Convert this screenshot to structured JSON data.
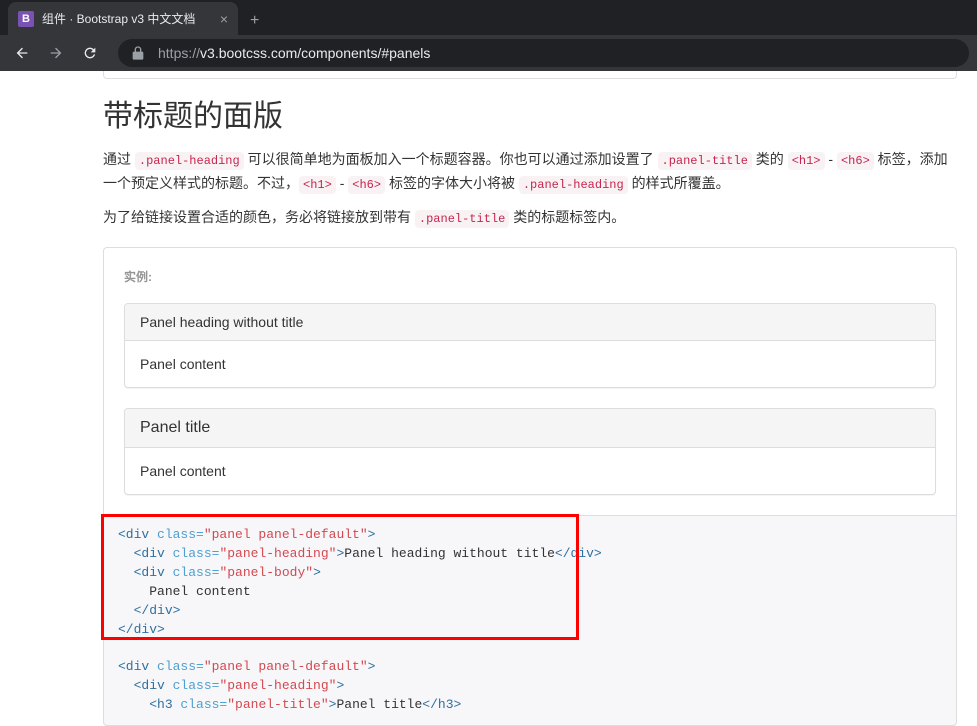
{
  "browser": {
    "tab_title": "组件 · Bootstrap v3 中文文档",
    "tab_favicon_letter": "B",
    "url_protocol": "https://",
    "url_rest": "v3.bootcss.com/components/#panels"
  },
  "page": {
    "heading": "带标题的面版",
    "para1_pre": "通过 ",
    "para1_code1": ".panel-heading",
    "para1_mid1": " 可以很简单地为面板加入一个标题容器。你也可以通过添加设置了 ",
    "para1_code2": ".panel-title",
    "para1_mid2": " 类的 ",
    "para1_code3": "<h1>",
    "para1_dash": " - ",
    "para1_code4": "<h6>",
    "para1_mid3": " 标签，添加一个预定义样式的标题。不过，",
    "para1_code5": "<h1>",
    "para1_code6": "<h6>",
    "para1_mid4": " 标签的字体大小将被 ",
    "para1_code7": ".panel-heading",
    "para1_end": " 的样式所覆盖。",
    "para2_pre": "为了给链接设置合适的颜色，务必将链接放到带有 ",
    "para2_code1": ".panel-title",
    "para2_end": " 类的标题标签内。",
    "example_label": "实例:",
    "panel1_heading": "Panel heading without title",
    "panel1_body": "Panel content",
    "panel2_title": "Panel title",
    "panel2_body": "Panel content",
    "code1_l1_a": "<div",
    "code1_l1_b": " class=",
    "code1_l1_c": "\"panel panel-default\"",
    "code1_l1_d": ">",
    "code1_l2_a": "<div",
    "code1_l2_b": " class=",
    "code1_l2_c": "\"panel-heading\"",
    "code1_l2_d": ">",
    "code1_l2_e": "Panel heading without title",
    "code1_l2_f": "</div>",
    "code1_l3_a": "<div",
    "code1_l3_b": " class=",
    "code1_l3_c": "\"panel-body\"",
    "code1_l3_d": ">",
    "code1_l4": "Panel content",
    "code1_l5": "</div>",
    "code1_l6": "</div>",
    "code2_l1_a": "<div",
    "code2_l1_b": " class=",
    "code2_l1_c": "\"panel panel-default\"",
    "code2_l1_d": ">",
    "code2_l2_a": "<div",
    "code2_l2_b": " class=",
    "code2_l2_c": "\"panel-heading\"",
    "code2_l2_d": ">",
    "code2_l3_a": "<h3",
    "code2_l3_b": " class=",
    "code2_l3_c": "\"panel-title\"",
    "code2_l3_d": ">",
    "code2_l3_e": "Panel title",
    "code2_l3_f": "</h3>"
  }
}
